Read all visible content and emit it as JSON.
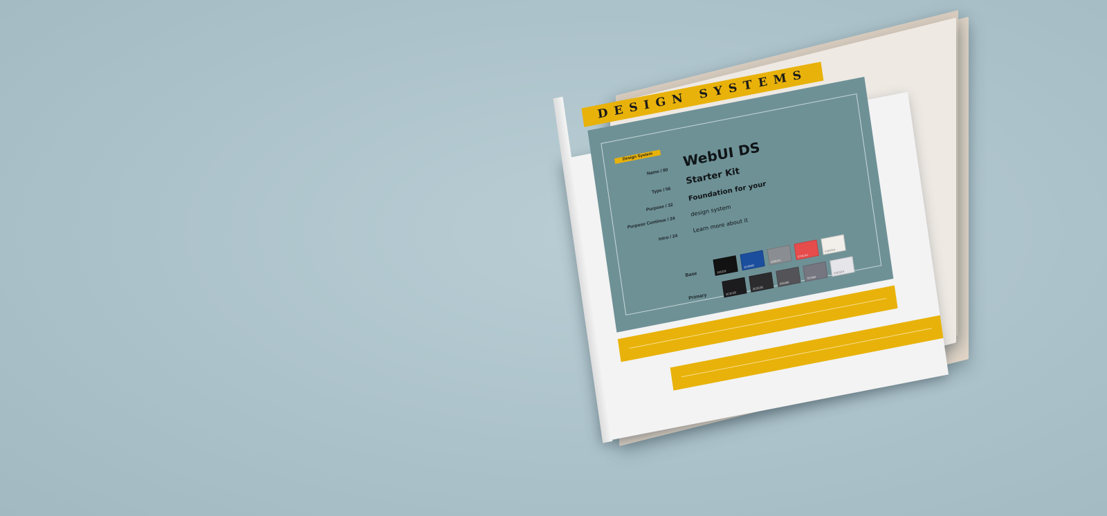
{
  "cover": {
    "header_title": "DESIGN SYSTEMS",
    "badge": "Design System",
    "rows": [
      {
        "label": "Name / 80",
        "value": "WebUI DS"
      },
      {
        "label": "Type / 56",
        "value": "Starter Kit"
      },
      {
        "label": "Purpose / 32",
        "value": "Foundation for your"
      },
      {
        "label": "Purpose Continue / 24",
        "value": "design system"
      },
      {
        "label": "Intro / 24",
        "value": "Learn more about it"
      }
    ],
    "palettes": [
      {
        "label": "Base",
        "swatches": [
          {
            "code": "121212",
            "color": "#121212"
          },
          {
            "code": "1C4E9E",
            "color": "#1c4e9e"
          },
          {
            "code": "8A8D91",
            "color": "#8a8d91"
          },
          {
            "code": "E74C4C",
            "color": "#e74c4c"
          },
          {
            "code": "F2EFEA",
            "color": "#f2efea"
          }
        ]
      },
      {
        "label": "Primary",
        "swatches": [
          {
            "code": "1C1C1E",
            "color": "#1c1c1e"
          },
          {
            "code": "2C2C2E",
            "color": "#2c2c2e"
          },
          {
            "code": "545458",
            "color": "#545458"
          },
          {
            "code": "767680",
            "color": "#767680"
          },
          {
            "code": "E5E5EA",
            "color": "#e5e5ea"
          }
        ]
      }
    ],
    "colors": {
      "accent": "#e8b20a",
      "panel": "#6e9196",
      "paper": "#f3f3f3",
      "background": "#acc2ca"
    }
  }
}
